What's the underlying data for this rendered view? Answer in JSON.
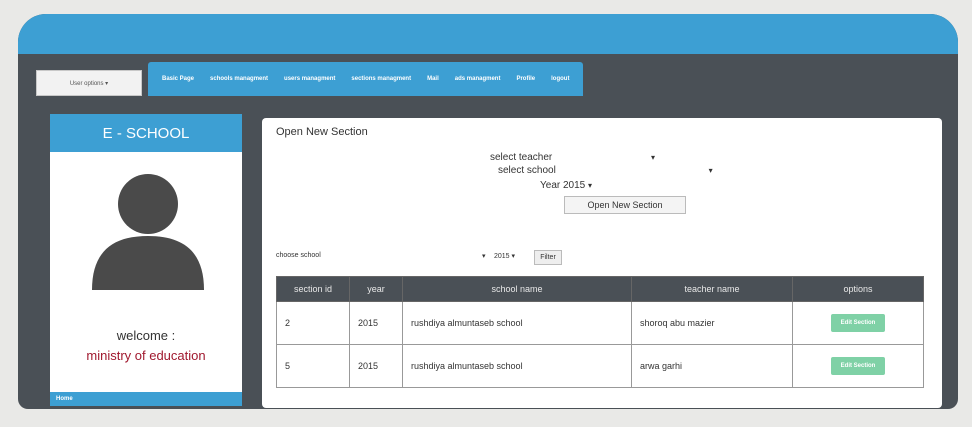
{
  "navbar": {
    "user_options": "User options ▾",
    "items": [
      "Basic Page",
      "schools managment",
      "users managment",
      "sections managment",
      "Mail",
      "ads managment",
      "Profile",
      "logout"
    ]
  },
  "sidebar": {
    "title": "E - SCHOOL",
    "welcome": "welcome :",
    "ministry": "ministry of education",
    "home": "Home"
  },
  "form": {
    "title": "Open New Section",
    "select_teacher": "select teacher",
    "select_school": "select school",
    "year_label": "Year",
    "year_value": "2015",
    "open_button": "Open New Section"
  },
  "filter": {
    "label": "choose school",
    "year": "2015",
    "button": "Filter"
  },
  "table": {
    "headers": [
      "section id",
      "year",
      "school name",
      "teacher name",
      "options"
    ],
    "rows": [
      {
        "section_id": "2",
        "year": "2015",
        "school": "rushdiya almuntaseb school",
        "teacher": "shoroq abu mazier",
        "action": "Edit Section"
      },
      {
        "section_id": "5",
        "year": "2015",
        "school": "rushdiya almuntaseb school",
        "teacher": "arwa garhi",
        "action": "Edit Section"
      }
    ]
  },
  "colors": {
    "accent": "#3d9fd3",
    "dark": "#4a5056",
    "ministry_text": "#a0182e",
    "edit_button": "#7fd1a6"
  }
}
